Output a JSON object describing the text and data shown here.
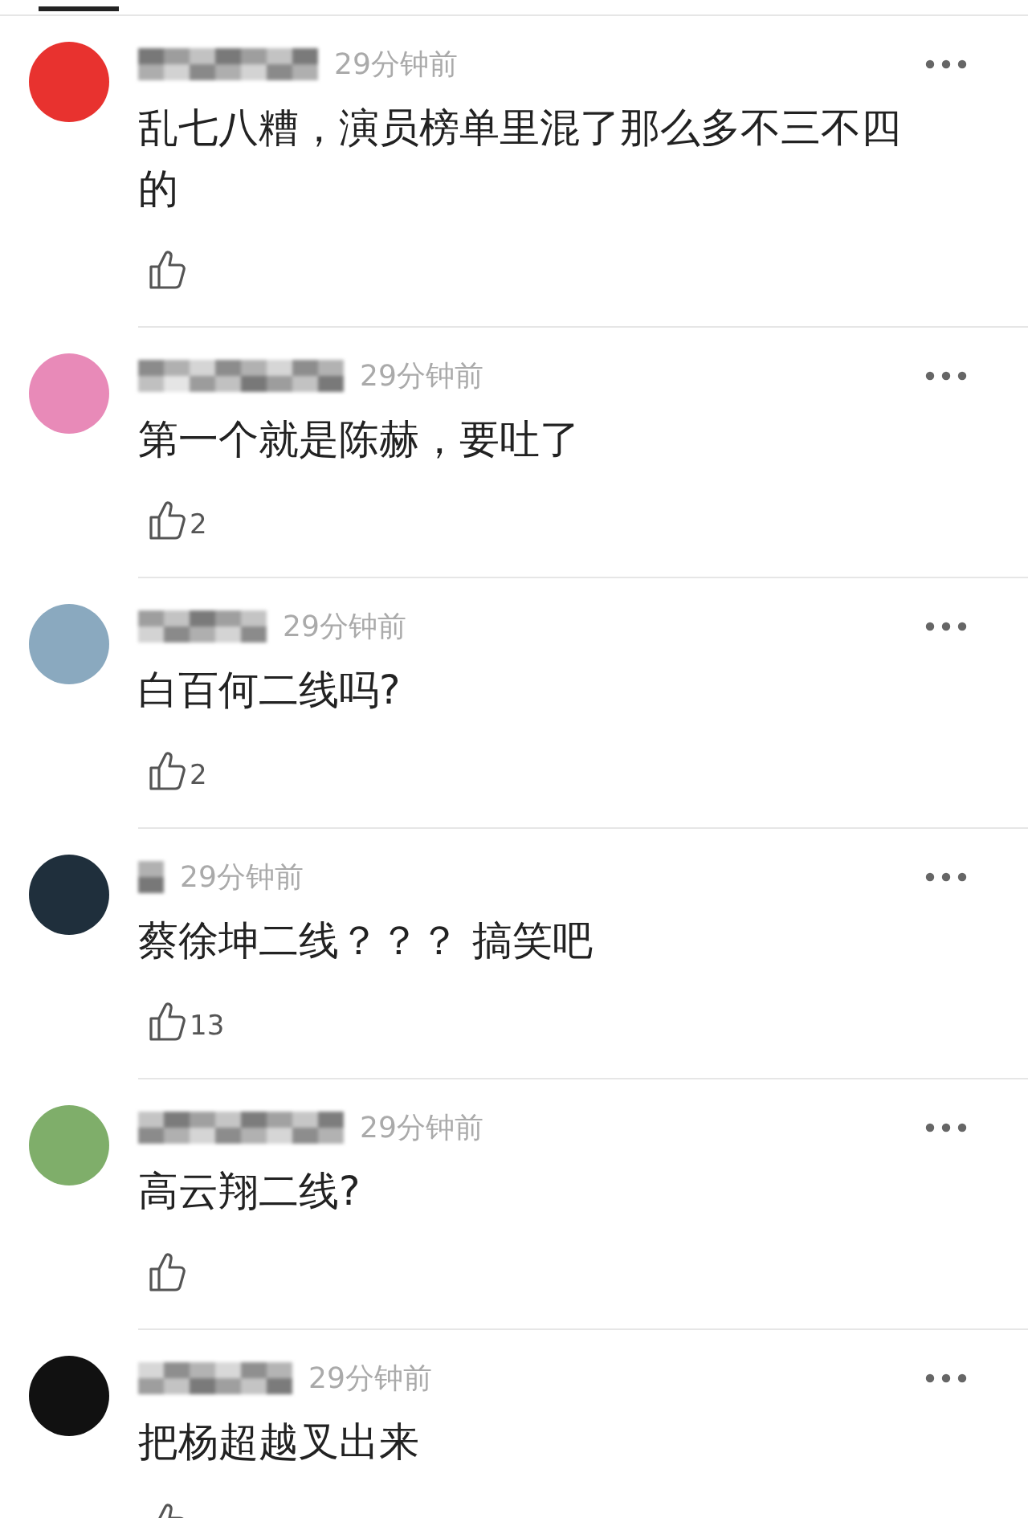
{
  "comments": [
    {
      "color": "#e8322f",
      "time": "29分钟前",
      "text": "乱七八糟，演员榜单里混了那么多不三不四的"
    },
    {
      "color": "#e88ab8",
      "time": "29分钟前",
      "text": "第一个就是陈赫，要吐了",
      "likes": "2"
    },
    {
      "color": "#8aa9bf",
      "time": "29分钟前",
      "text": "白百何二线吗?",
      "likes": "2"
    },
    {
      "color": "#1f2f3c",
      "time": "29分钟前",
      "text": "蔡徐坤二线？？？ 搞笑吧",
      "likes": "13"
    },
    {
      "color": "#7fae6a",
      "time": "29分钟前",
      "text": "高云翔二线?"
    },
    {
      "color": "#111111",
      "time": "29分钟前",
      "text": "把杨超越叉出来"
    }
  ]
}
